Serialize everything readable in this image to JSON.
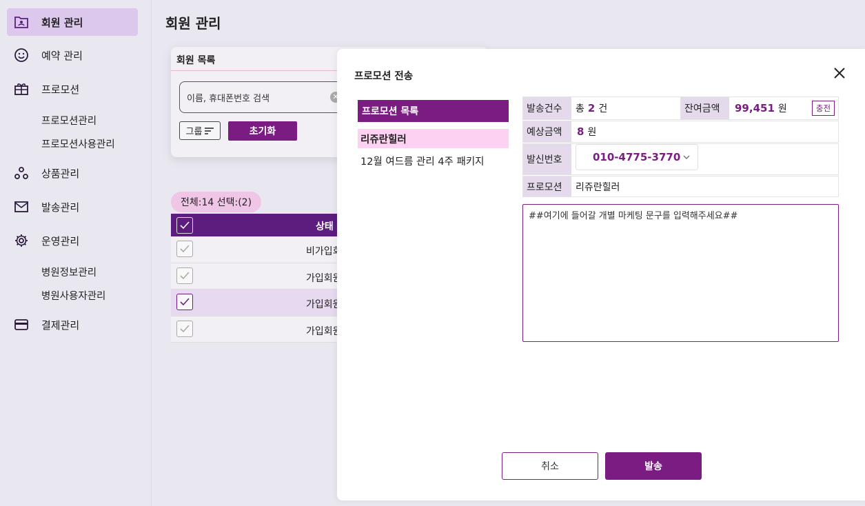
{
  "sidebar": {
    "items": [
      {
        "label": "회원 관리",
        "icon": "member-card-icon",
        "active": true
      },
      {
        "label": "예약 관리",
        "icon": "smile-icon"
      },
      {
        "label": "프로모션",
        "icon": "gift-icon"
      },
      {
        "label": "상품관리",
        "icon": "nodes-icon"
      },
      {
        "label": "발송관리",
        "icon": "mail-icon"
      },
      {
        "label": "운영관리",
        "icon": "gear-icon"
      },
      {
        "label": "결제관리",
        "icon": "card-icon"
      }
    ],
    "promotion_subs": [
      "프로모션관리",
      "프로모션사용관리"
    ],
    "operation_subs": [
      "병원정보관리",
      "병원사용자관리"
    ]
  },
  "main": {
    "title": "회원 관리",
    "panel_title": "회원 목록",
    "search_placeholder": "이름, 휴대폰번호 검색",
    "group_label": "그룹",
    "reset_label": "초기화",
    "count_text": "전체:14 선택:(2)",
    "table": {
      "header": "상태",
      "rows": [
        {
          "status": "비가입회",
          "checked": false
        },
        {
          "status": "가입회원",
          "checked": false
        },
        {
          "status": "가입회원",
          "checked": true
        },
        {
          "status": "가입회원",
          "checked": false
        }
      ]
    }
  },
  "modal": {
    "title": "프로모션 전송",
    "list_title": "프로모션 목록",
    "promotions": [
      "리쥬란힐러",
      "12월 여드름 관리 4주 패키지"
    ],
    "send_count_label": "발송건수",
    "send_count_prefix": "총",
    "send_count_value": "2",
    "send_count_unit": "건",
    "balance_label": "잔여금액",
    "balance_value": "99,451",
    "balance_unit": "원",
    "charge_label": "충전",
    "expected_label": "예상금액",
    "expected_value": "8",
    "expected_unit": "원",
    "sender_label": "발신번호",
    "sender_number": "010-4775-3770",
    "promotion_label": "프로모션",
    "promotion_value": "리쥬란힐러",
    "message": "##여기에 들어갈 개별 마케팅 문구를 입력해주세요##",
    "cancel_label": "취소",
    "send_label": "발송"
  },
  "colors": {
    "primary": "#7b1c83",
    "header_purple": "#5c1d7e",
    "active_nav": "#dcc8ec",
    "pill": "#f0c6e6",
    "selected_promo": "#fcd1f2"
  }
}
